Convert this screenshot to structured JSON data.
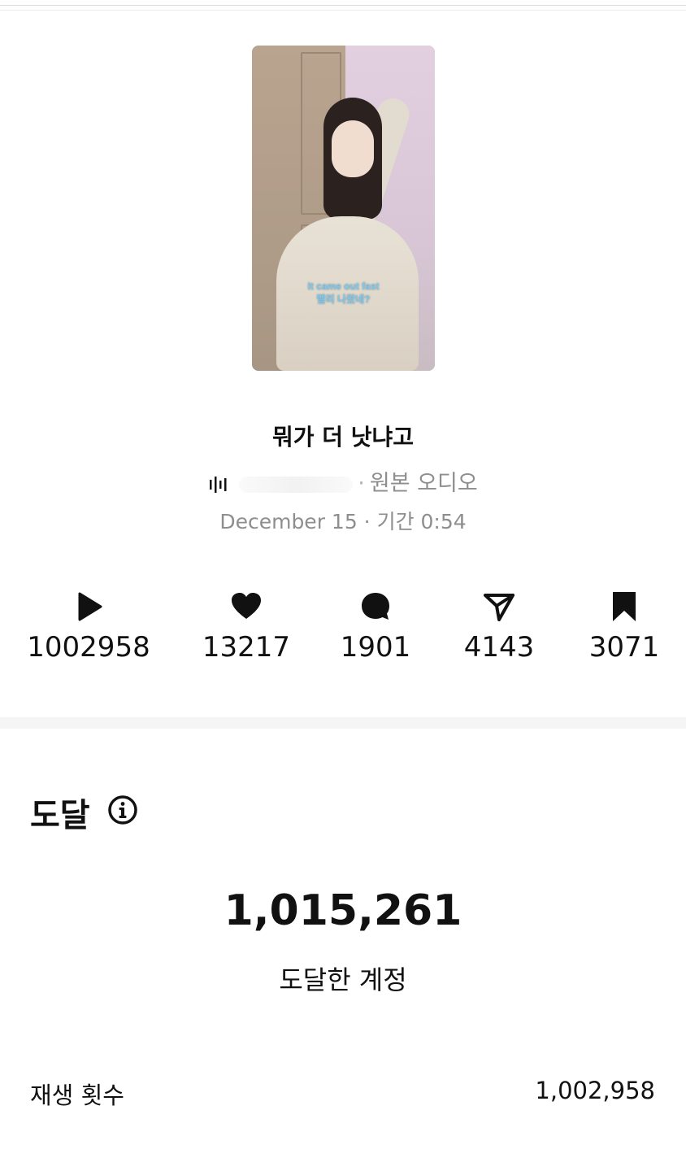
{
  "post": {
    "subtitle_line1": "It came out fast",
    "subtitle_line2": "빨리 나왔네?",
    "title": "뭐가 더 낫냐고",
    "audio_label": "원본 오디오",
    "date_duration": "December 15 · 기간 0:54"
  },
  "stats": [
    {
      "icon": "play-icon",
      "value": "1002958"
    },
    {
      "icon": "heart-icon",
      "value": "13217"
    },
    {
      "icon": "comment-icon",
      "value": "1901"
    },
    {
      "icon": "share-icon",
      "value": "4143"
    },
    {
      "icon": "bookmark-icon",
      "value": "3071"
    }
  ],
  "reach": {
    "section_title": "도달",
    "info_icon": "info-icon",
    "accounts_reached_value": "1,015,261",
    "accounts_reached_label": "도달한 계정",
    "plays_label": "재생 횟수",
    "plays_value": "1,002,958"
  },
  "colors": {
    "text": "#111111",
    "muted": "#8e8e8e",
    "divider": "#f5f5f5"
  }
}
